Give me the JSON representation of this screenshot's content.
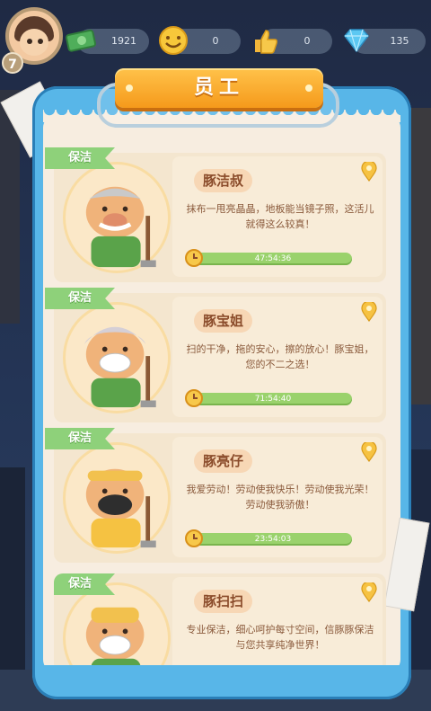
{
  "resources": {
    "cash": "1921",
    "smile": "0",
    "thumb": "0",
    "diamond": "135"
  },
  "player": {
    "level": "7"
  },
  "panel": {
    "title": "员工"
  },
  "employees": [
    {
      "tag": "保洁",
      "name": "豚洁叔",
      "desc": "抹布一甩亮晶晶，地板能当镜子照，这活儿就得这么较真！",
      "timer": "47:54:36",
      "progress": 1.0
    },
    {
      "tag": "保洁",
      "name": "豚宝姐",
      "desc": "扫的干净，拖的安心，擦的放心！豚宝姐，您的不二之选！",
      "timer": "71:54:40",
      "progress": 1.0
    },
    {
      "tag": "保洁",
      "name": "豚亮仔",
      "desc": "我爱劳动！劳动使我快乐！劳动使我光荣！劳动使我骄傲！",
      "timer": "23:54:03",
      "progress": 1.0
    },
    {
      "tag": "保洁",
      "name": "豚扫扫",
      "desc": "专业保洁，细心呵护每寸空间，信豚豚保洁与您共享纯净世界！",
      "timer": "",
      "progress": 1.0
    }
  ],
  "colors": {
    "panel_blue": "#58b6e8",
    "banner_orange": "#f59a1b",
    "tag_green": "#8ed17a",
    "timer_green": "#9ad26c"
  }
}
